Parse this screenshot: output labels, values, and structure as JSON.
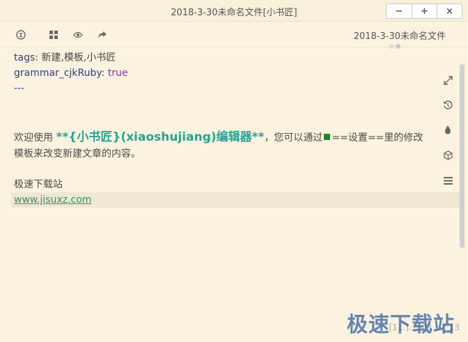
{
  "window": {
    "title": "2018-3-30未命名文件[小书匠]",
    "minimize_glyph": "−",
    "maximize_glyph": "+",
    "close_glyph": "×"
  },
  "toolbar": {
    "doc_name": "2018-3-30未命名文件",
    "icons": [
      "logo-icon",
      "grid-icon",
      "eye-icon",
      "share-icon"
    ]
  },
  "editor": {
    "cut_line": "   ·   ·   ·   ·",
    "lines": [
      {
        "key": "tags",
        "sep": ": ",
        "value": "新建,模板,小书匠"
      },
      {
        "key": "grammar_cjkRuby",
        "sep": ": ",
        "value": "true"
      },
      {
        "text": "---"
      },
      {
        "intro": "欢迎使用 ",
        "strong": "**{小书匠}(xiaoshujiang)编辑器**",
        "after": "，您可以通过",
        "after2": "==设置==里的修改"
      },
      {
        "text": "模板来改变新建文章的内容。"
      },
      {
        "text": "极速下载站"
      },
      {
        "link": "www.jisuxz.com"
      }
    ]
  },
  "right_tools": [
    "expand-icon",
    "history-icon",
    "drop-icon",
    "cube-icon",
    "menu-icon"
  ],
  "status": {
    "text": "[1...]...: 11  ...: 13"
  },
  "watermark": {
    "text": "极速下载站"
  },
  "colors": {
    "background": "#fbf3df",
    "key": "#2f3b8a",
    "strong": "#2aa198",
    "link": "#3b8c6e",
    "true_value": "#8a2cb0"
  }
}
